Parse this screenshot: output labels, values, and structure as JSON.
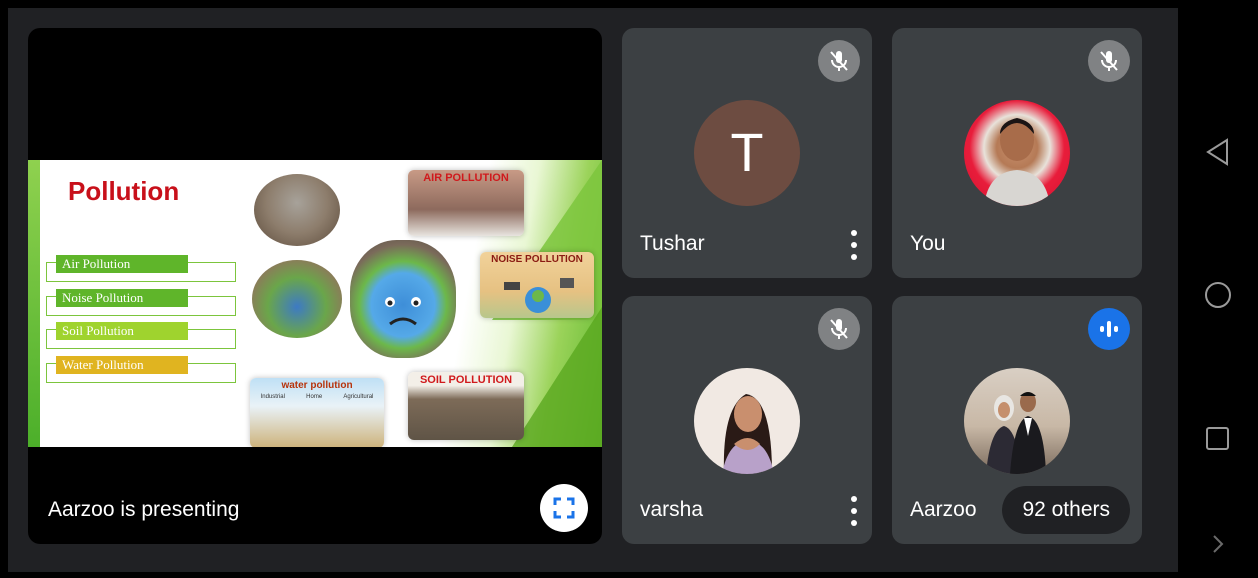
{
  "presentation": {
    "label": "Aarzoo is presenting",
    "slide": {
      "title": "Pollution",
      "types": [
        {
          "label": "Air Pollution",
          "color": "#5fb52a"
        },
        {
          "label": "Noise Pollution",
          "color": "#5fb52a"
        },
        {
          "label": "Soil Pollution",
          "color": "#9fd32e"
        },
        {
          "label": "Water Pollution",
          "color": "#e0b420"
        }
      ],
      "cards": {
        "air": "AIR POLLUTION",
        "noise": "NOISE POLLUTION",
        "water": "water pollution",
        "water_sub": [
          "Industrial",
          "Home",
          "Agricultural"
        ],
        "soil": "SOIL POLLUTION"
      }
    },
    "fullscreen_icon": "fullscreen-icon"
  },
  "participants": [
    {
      "name": "Tushar",
      "avatar_letter": "T",
      "avatar_color": "#6d4c41",
      "muted": true
    },
    {
      "name": "You",
      "muted": true
    },
    {
      "name": "varsha",
      "muted": true
    },
    {
      "name": "Aarzoo",
      "speaking": true
    }
  ],
  "others": {
    "label": "92 others"
  },
  "colors": {
    "meet_bg": "#202124",
    "tile_bg": "#3c4043",
    "speaking": "#1a73e8",
    "title_red": "#c8101a"
  },
  "nav": {
    "back_icon": "back-triangle-icon",
    "home_icon": "home-circle-icon",
    "recents_icon": "recents-square-icon",
    "more_icon": "chevron-right-icon"
  }
}
